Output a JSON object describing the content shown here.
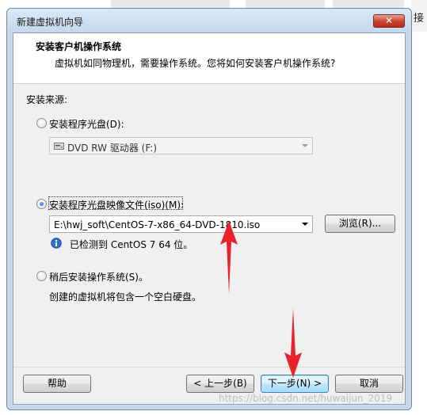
{
  "background": {
    "right_text": "接"
  },
  "window": {
    "title": "新建虚拟机向导",
    "close_glyph": "✕"
  },
  "header": {
    "title": "安装客户机操作系统",
    "subtitle": "虚拟机如同物理机，需要操作系统。您将如何安装客户机操作系统?"
  },
  "source": {
    "label": "安装来源:",
    "options": [
      {
        "label": "安装程序光盘(D):",
        "selected": false
      },
      {
        "label": "安装程序光盘映像文件(iso)(M):",
        "selected": true
      },
      {
        "label": "稍后安装操作系统(S)。",
        "selected": false
      }
    ],
    "drive_combo_value": "DVD RW 驱动器 (F:)",
    "iso_combo_value": "E:\\hwj_soft\\CentOS-7-x86_64-DVD-1810.iso",
    "browse_label": "浏览(R)...",
    "detected_text": "已检测到 CentOS 7 64 位。",
    "later_desc": "创建的虚拟机将包含一个空白硬盘。"
  },
  "footer": {
    "help_label": "帮助",
    "back_label": "< 上一步(B)",
    "next_label": "下一步(N) >",
    "cancel_label": "取消"
  },
  "watermark": "https://blog.csdn.net/huwaijun_2019",
  "colors": {
    "annotation_arrow": "#e8212b",
    "accent": "#3c7fb1"
  }
}
